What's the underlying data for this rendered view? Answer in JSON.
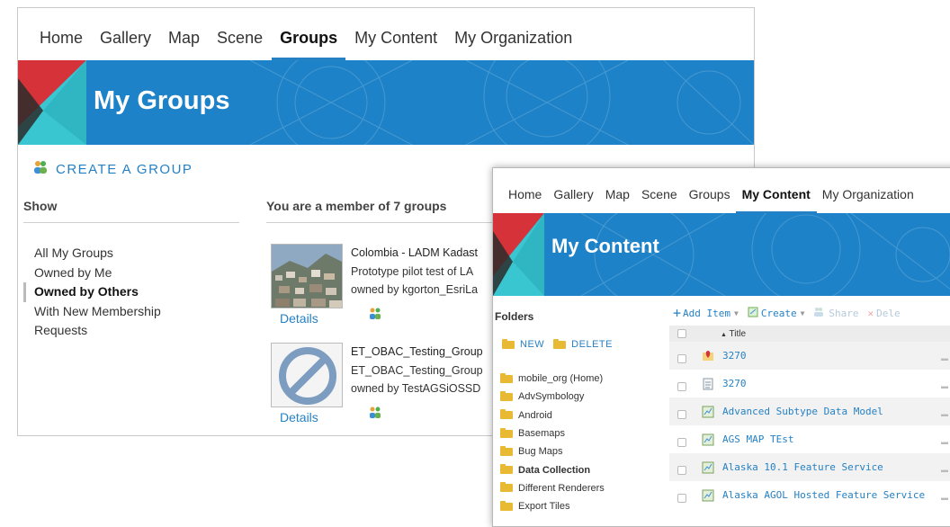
{
  "groups_window": {
    "nav": [
      "Home",
      "Gallery",
      "Map",
      "Scene",
      "Groups",
      "My Content",
      "My Organization"
    ],
    "active_nav": "Groups",
    "banner_title": "My Groups",
    "create_group": "CREATE A GROUP",
    "show_header": "Show",
    "show_items": [
      "All My Groups",
      "Owned by Me",
      "Owned by Others",
      "With New Membership Requests"
    ],
    "active_show": "Owned by Others",
    "members_header": "You are a member of 7 groups",
    "groups": [
      {
        "name": "Colombia - LADM Kadast",
        "desc": "Prototype pilot test of LA",
        "owner": "owned by kgorton_EsriLa",
        "details": "Details",
        "thumb": "city-photo"
      },
      {
        "name": "ET_OBAC_Testing_Group",
        "desc": "ET_OBAC_Testing_Group",
        "owner": "owned by TestAGSiOSSD",
        "details": "Details",
        "thumb": "no-thumbnail-icon"
      }
    ]
  },
  "content_window": {
    "nav": [
      "Home",
      "Gallery",
      "Map",
      "Scene",
      "Groups",
      "My Content",
      "My Organization"
    ],
    "active_nav": "My Content",
    "banner_title": "My Content",
    "folders_header": "Folders",
    "folder_actions": {
      "new": "NEW",
      "delete": "DELETE"
    },
    "folders": [
      "mobile_org (Home)",
      "AdvSymbology",
      "Android",
      "Basemaps",
      "Bug Maps",
      "Data Collection",
      "Different Renderers",
      "Export Tiles"
    ],
    "active_folder": "Data Collection",
    "toolbar": {
      "add": "Add Item",
      "create": "Create",
      "share": "Share",
      "delete": "Dele"
    },
    "title_column": "Title",
    "items": [
      {
        "title": "3270",
        "icon": "map-pin-icon"
      },
      {
        "title": "3270",
        "icon": "document-icon"
      },
      {
        "title": "Advanced Subtype Data Model",
        "icon": "feature-layer-icon"
      },
      {
        "title": "AGS MAP TEst",
        "icon": "feature-layer-icon"
      },
      {
        "title": "Alaska 10.1 Feature Service",
        "icon": "feature-layer-icon"
      },
      {
        "title": "Alaska AGOL Hosted Feature Service",
        "icon": "feature-layer-icon"
      }
    ]
  },
  "colors": {
    "accent": "#2681c4",
    "banner": "#1d82c7",
    "logo_red": "#d6323a",
    "logo_teal": "#3ac6d1"
  }
}
